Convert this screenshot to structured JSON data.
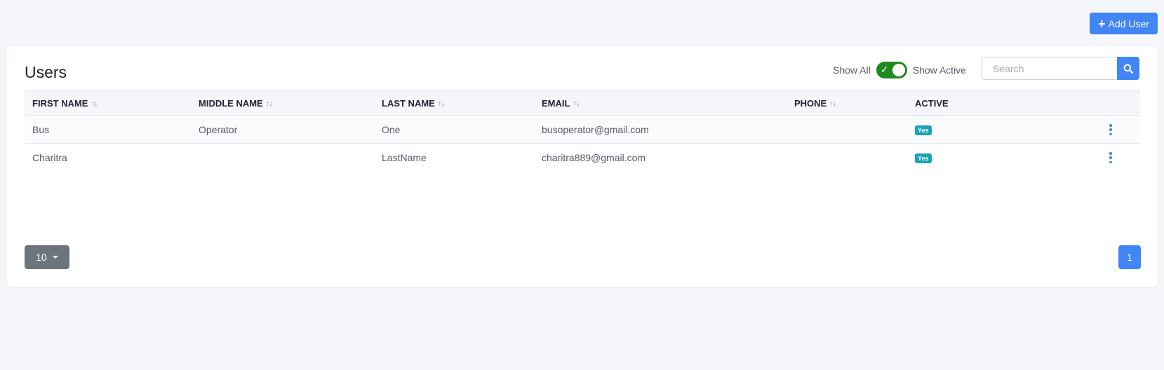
{
  "header": {
    "add_user_label": "Add User"
  },
  "card": {
    "title": "Users",
    "show_all_label": "Show All",
    "show_active_label": "Show Active",
    "toggle_on": true,
    "search": {
      "placeholder": "Search",
      "value": ""
    }
  },
  "table": {
    "columns": [
      "FIRST NAME",
      "MIDDLE NAME",
      "LAST NAME",
      "EMAIL",
      "PHONE",
      "ACTIVE"
    ],
    "rows": [
      {
        "first": "Bus",
        "middle": "Operator",
        "last": "One",
        "email": "busoperator@gmail.com",
        "phone": "",
        "active": "Yes"
      },
      {
        "first": "Charitra",
        "middle": "",
        "last": "LastName",
        "email": "charitra889@gmail.com",
        "phone": "",
        "active": "Yes"
      }
    ]
  },
  "footer": {
    "page_size": "10",
    "current_page": "1"
  },
  "colors": {
    "primary": "#4285f4",
    "toggle": "#1e8a1e",
    "badge": "#17a2b8",
    "secondary": "#6c757d"
  }
}
